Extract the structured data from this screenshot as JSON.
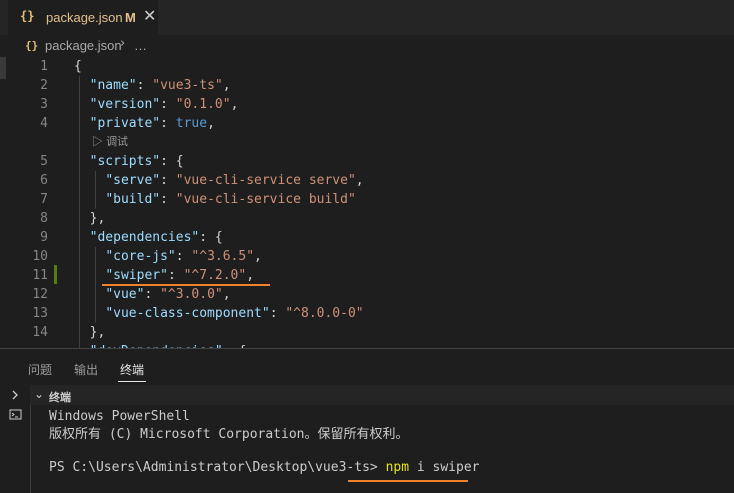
{
  "tab": {
    "icon": "{}",
    "name": "package.json",
    "status": "M",
    "close": "✕"
  },
  "breadcrumb": {
    "icon": "{}",
    "file": "package.json",
    "separator": "›",
    "more": "…"
  },
  "editor": {
    "codelens": "调试",
    "line_numbers": [
      "1",
      "2",
      "3",
      "4",
      "5",
      "6",
      "7",
      "8",
      "9",
      "10",
      "11",
      "12",
      "13",
      "14"
    ],
    "lines": [
      "{",
      "  \"name\": \"vue3-ts\",",
      "  \"version\": \"0.1.0\",",
      "  \"private\": true,",
      "  \"scripts\": {",
      "    \"serve\": \"vue-cli-service serve\",",
      "    \"build\": \"vue-cli-service build\"",
      "  },",
      "  \"dependencies\": {",
      "    \"core-js\": \"^3.6.5\",",
      "    \"swiper\": \"^7.2.0\",",
      "    \"vue\": \"^3.0.0\",",
      "    \"vue-class-component\": \"^8.0.0-0\"",
      "  },",
      "  \"devDependencies\": {"
    ]
  },
  "panel": {
    "tabs": [
      "问题",
      "输出",
      "终端"
    ],
    "active_tab": "终端",
    "terminal_title": "终端",
    "lines": [
      "Windows PowerShell",
      "版权所有 (C) Microsoft Corporation。保留所有权利。"
    ],
    "prompt": "PS C:\\Users\\Administrator\\Desktop\\vue3-ts>",
    "command": "npm",
    "args": "i swiper"
  },
  "colors": {
    "accent_underline": "#f0832a",
    "modified": "#e2c08d",
    "key": "#9cdcfe",
    "string": "#ce9178"
  }
}
